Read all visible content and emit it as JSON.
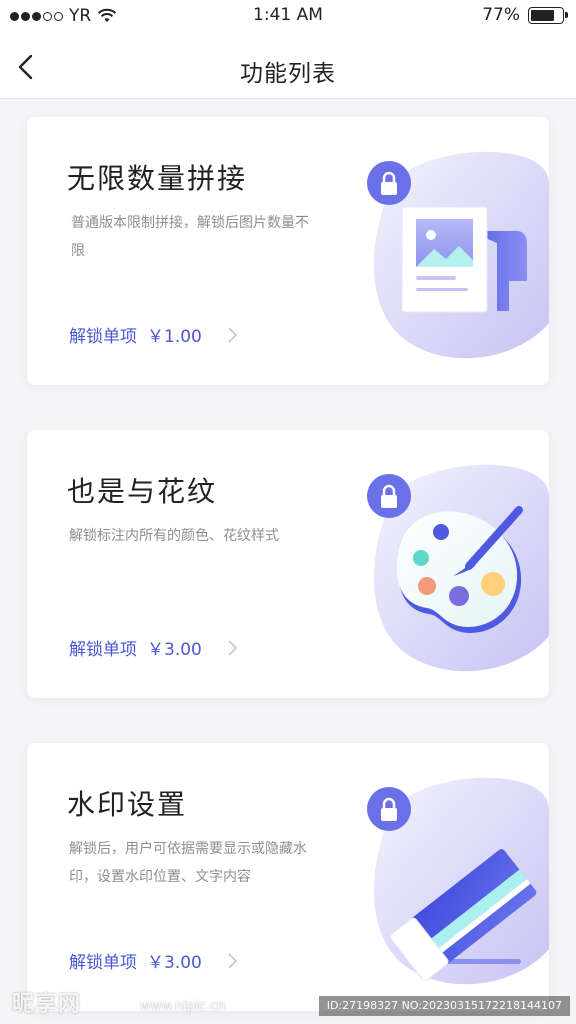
{
  "status_bar": {
    "carrier": "YR",
    "time": "1:41 AM",
    "battery_text": "77%",
    "battery_level": 0.77
  },
  "header": {
    "title": "功能列表"
  },
  "cards": [
    {
      "title": "无限数量拼接",
      "description": "普通版本限制拼接，解锁后图片数量不限",
      "unlock_label": "解锁单项",
      "price": "￥1.00"
    },
    {
      "title": "也是与花纹",
      "description": "解锁标注内所有的颜色、花纹样式",
      "unlock_label": "解锁单项",
      "price": "￥3.00"
    },
    {
      "title": "水印设置",
      "description": "解锁后，用户可依据需要显示或隐藏水印，设置水印位置、文字内容",
      "unlock_label": "解锁单项",
      "price": "￥3.00"
    }
  ],
  "watermark": {
    "logo": "昵享网",
    "url": "www.nipic.cn",
    "id": "ID:27198327 NO:20230315172218144107"
  },
  "colors": {
    "accent": "#4a58d6",
    "lock_badge": "#6a70e8",
    "blob_light": "#eef0fb",
    "blob_purple": "#c9c5f5"
  }
}
